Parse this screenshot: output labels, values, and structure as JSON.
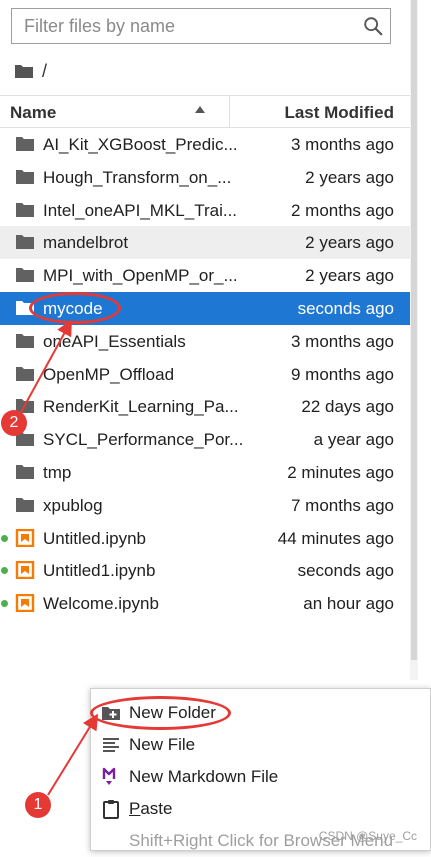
{
  "filter": {
    "placeholder": "Filter files by name",
    "value": ""
  },
  "breadcrumb": {
    "separator": "/"
  },
  "header": {
    "name_label": "Name",
    "modified_label": "Last Modified"
  },
  "files": [
    {
      "name": "AI_Kit_XGBoost_Predic...",
      "modified": "3 months ago",
      "type": "folder"
    },
    {
      "name": "Hough_Transform_on_...",
      "modified": "2 years ago",
      "type": "folder"
    },
    {
      "name": "Intel_oneAPI_MKL_Trai...",
      "modified": "2 months ago",
      "type": "folder"
    },
    {
      "name": "mandelbrot",
      "modified": "2 years ago",
      "type": "folder"
    },
    {
      "name": "MPI_with_OpenMP_or_...",
      "modified": "2 years ago",
      "type": "folder"
    },
    {
      "name": "mycode",
      "modified": "seconds ago",
      "type": "folder"
    },
    {
      "name": "oneAPI_Essentials",
      "modified": "3 months ago",
      "type": "folder"
    },
    {
      "name": "OpenMP_Offload",
      "modified": "9 months ago",
      "type": "folder"
    },
    {
      "name": "RenderKit_Learning_Pa...",
      "modified": "22 days ago",
      "type": "folder"
    },
    {
      "name": "SYCL_Performance_Por...",
      "modified": "a year ago",
      "type": "folder"
    },
    {
      "name": "tmp",
      "modified": "2 minutes ago",
      "type": "folder"
    },
    {
      "name": "xpublog",
      "modified": "7 months ago",
      "type": "folder"
    },
    {
      "name": "Untitled.ipynb",
      "modified": "44 minutes ago",
      "type": "notebook"
    },
    {
      "name": "Untitled1.ipynb",
      "modified": "seconds ago",
      "type": "notebook"
    },
    {
      "name": "Welcome.ipynb",
      "modified": "an hour ago",
      "type": "notebook"
    }
  ],
  "context_menu": {
    "new_folder": "New Folder",
    "new_file": "New File",
    "new_markdown": "New Markdown File",
    "paste_prefix": "P",
    "paste_rest": "aste",
    "browser_menu": "Shift+Right Click for Browser Menu"
  },
  "annotations": {
    "badge_1": "1",
    "badge_2": "2"
  },
  "watermark": "CSDN @Suye_Cc",
  "colors": {
    "selected": "#1e77d3",
    "annotation": "#e53935",
    "notebook": "#f57c00",
    "running_dot": "#4caf50",
    "markdown": "#7b1fa2"
  }
}
